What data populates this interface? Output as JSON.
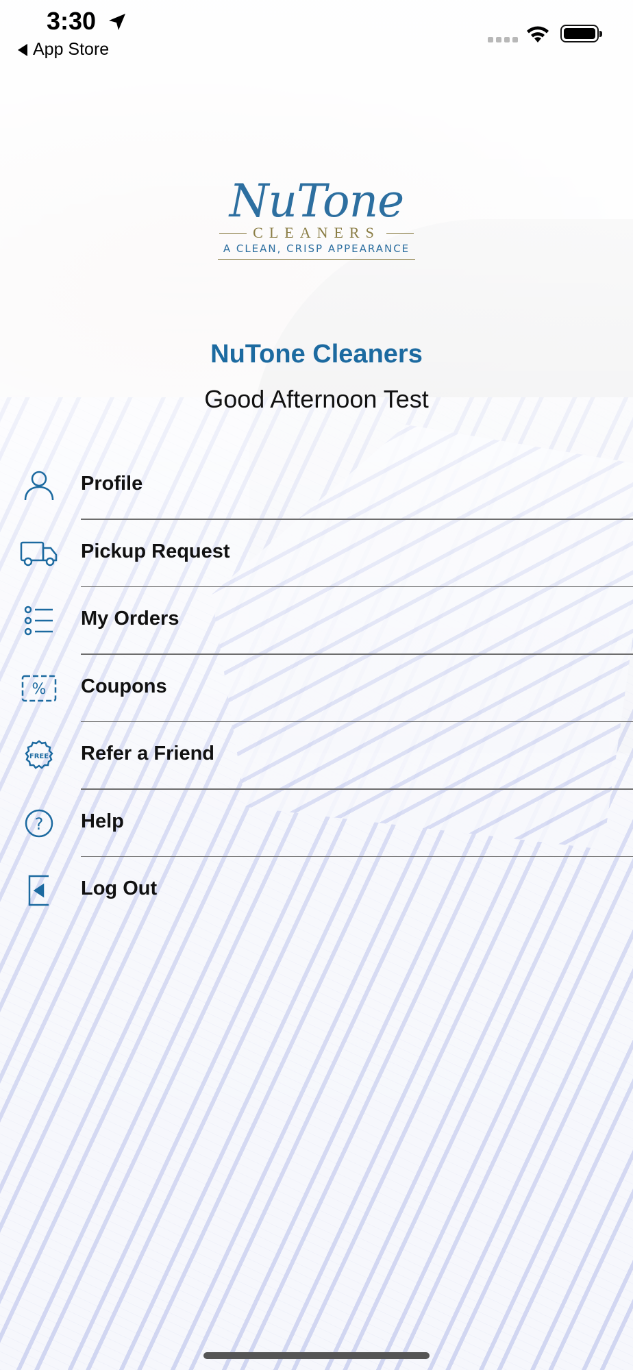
{
  "status_bar": {
    "time": "3:30",
    "back_label": "App Store"
  },
  "logo": {
    "script": "NuTone",
    "subtitle": "CLEANERS",
    "tagline": "A CLEAN, CRISP APPEARANCE"
  },
  "header": {
    "app_name": "NuTone Cleaners",
    "greeting": "Good Afternoon Test"
  },
  "menu": {
    "items": [
      {
        "label": "Profile",
        "icon": "person-icon"
      },
      {
        "label": "Pickup Request",
        "icon": "truck-icon"
      },
      {
        "label": "My Orders",
        "icon": "list-icon"
      },
      {
        "label": "Coupons",
        "icon": "coupon-icon"
      },
      {
        "label": "Refer a Friend",
        "icon": "free-badge-icon"
      },
      {
        "label": "Help",
        "icon": "help-icon"
      },
      {
        "label": "Log Out",
        "icon": "logout-icon"
      }
    ],
    "free_badge_text": "FREE",
    "coupon_symbol": "%",
    "help_symbol": "?"
  },
  "colors": {
    "brand_blue": "#1c6aa0",
    "logo_gold": "#8a7d45"
  }
}
